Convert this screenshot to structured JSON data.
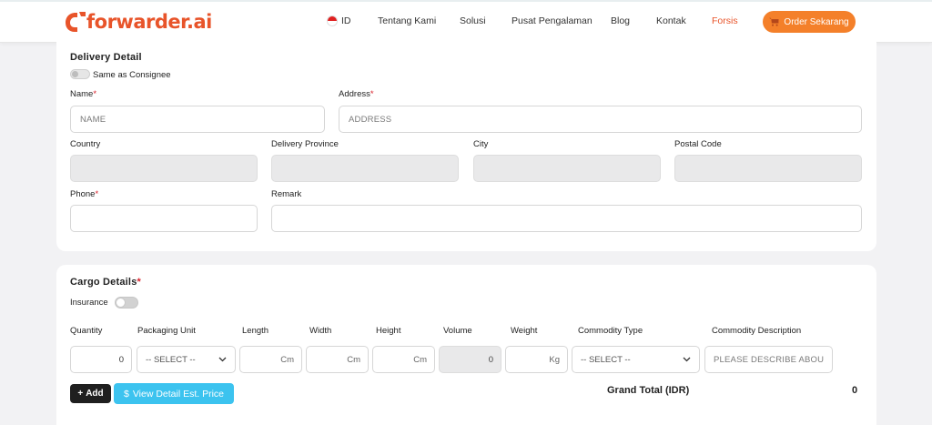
{
  "nav": {
    "brand": "forwarder.ai",
    "lang": "ID",
    "items": [
      "Tentang Kami",
      "Solusi",
      "Pusat Pengalaman",
      "Blog",
      "Kontak",
      "Forsis"
    ],
    "active_item": "Forsis",
    "order_button": "Order Sekarang",
    "brand_color": "#e8542a",
    "button_color": "#f4802a"
  },
  "delivery": {
    "title": "Delivery Detail",
    "same_as_consignee": "Same as Consignee",
    "same_as_consignee_on": false,
    "name_label": "Name",
    "name_placeholder": "NAME",
    "address_label": "Address",
    "address_placeholder": "ADDRESS",
    "required_mark": "*",
    "country_label": "Country",
    "province_label": "Delivery Province",
    "city_label": "City",
    "postal_label": "Postal Code",
    "phone_label": "Phone",
    "remark_label": "Remark"
  },
  "cargo": {
    "title": "Cargo Details",
    "insurance_label": "Insurance",
    "insurance_on": false,
    "columns": [
      "Quantity",
      "Packaging Unit",
      "Length",
      "Width",
      "Height",
      "Volume",
      "Weight",
      "Commodity Type",
      "Commodity Description"
    ],
    "quantity_value": "0",
    "packaging_select": "-- SELECT --",
    "length_unit": "Cm",
    "width_unit": "Cm",
    "height_unit": "Cm",
    "volume_value": "0",
    "weight_unit": "Kg",
    "commodity_select": "-- SELECT --",
    "description_placeholder": "PLEASE DESCRIBE ABOUT",
    "add_button": "Add",
    "view_button": "View Detail Est. Price",
    "grand_total_label": "Grand Total (IDR)",
    "grand_total_value": "0"
  }
}
